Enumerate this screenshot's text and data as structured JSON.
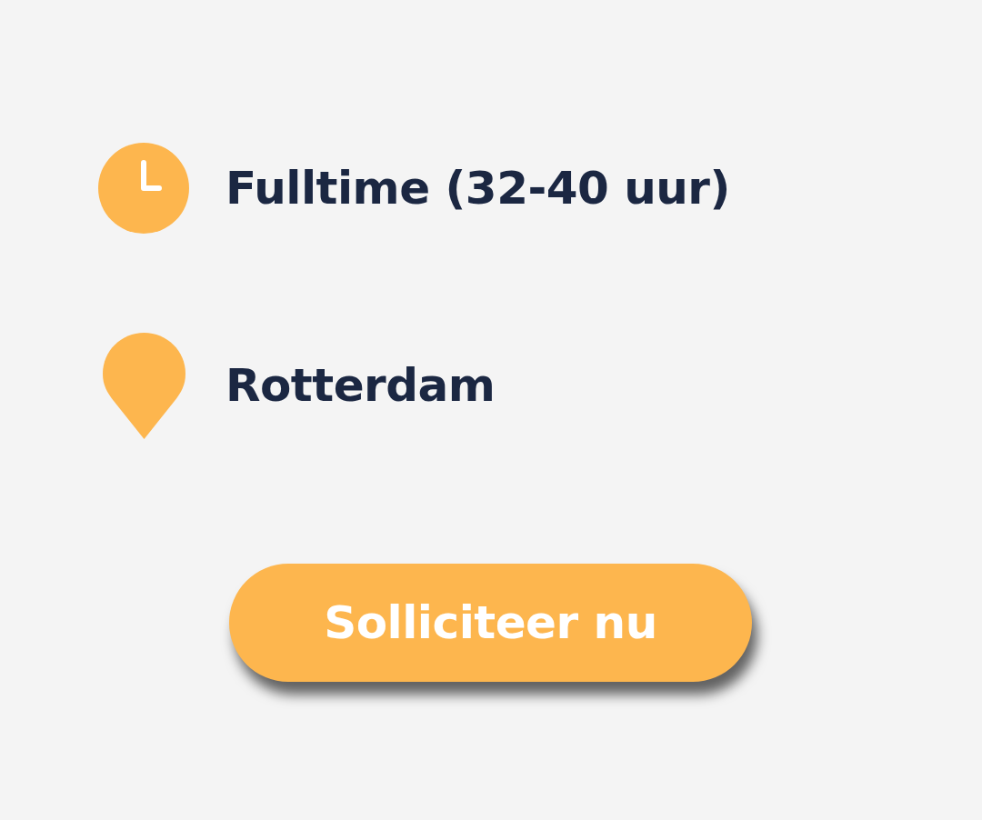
{
  "details": [
    {
      "kind": "clock",
      "label": "Fulltime (32-40 uur)"
    },
    {
      "kind": "location",
      "label": "Rotterdam"
    }
  ],
  "apply_button": {
    "label": "Solliciteer nu"
  }
}
